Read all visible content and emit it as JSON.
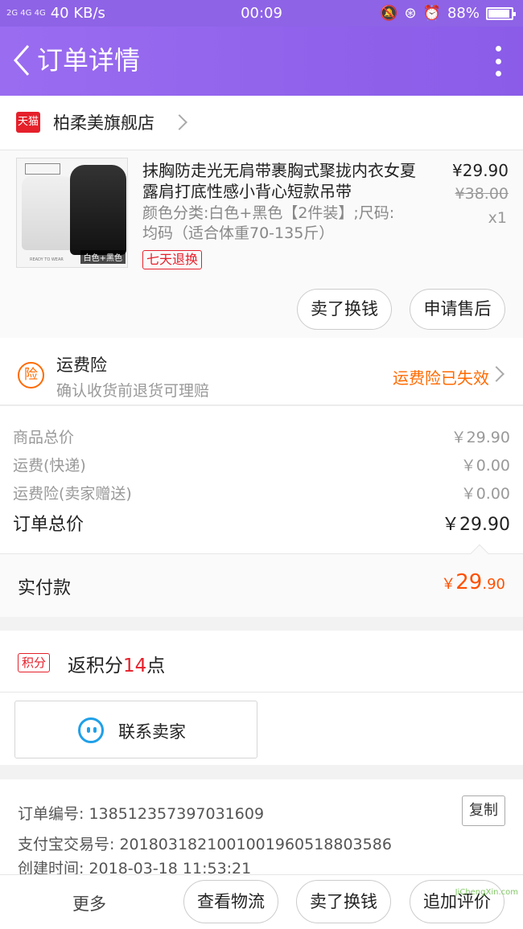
{
  "status": {
    "network": "2G 4G 4G",
    "speed": "40 KB/s",
    "time": "00:09",
    "battery": "88%"
  },
  "header": {
    "title": "订单详情"
  },
  "shop": {
    "badge": "天猫",
    "name": "柏柔美旗舰店"
  },
  "product": {
    "title": "抹胸防走光无肩带裹胸式聚拢内衣女夏露肩打底性感小背心短款吊带",
    "spec": "颜色分类:白色+黑色【2件装】;尺码:均码（适合体重70-135斤）",
    "badge": "七天退换",
    "image_tag": "白色+黑色",
    "image_caption": "READY TO WEAR",
    "price": "¥29.90",
    "original_price": "¥38.00",
    "quantity": "x1",
    "btn_exchange": "卖了换钱",
    "btn_aftersale": "申请售后"
  },
  "insurance": {
    "icon": "险",
    "title": "运费险",
    "subtitle": "确认收货前退货可理赔",
    "status": "运费险已失效"
  },
  "totals": {
    "rows": [
      {
        "label": "商品总价",
        "value": "￥29.90"
      },
      {
        "label": "运费(快递)",
        "value": "￥0.00"
      },
      {
        "label": "运费险(卖家赠送)",
        "value": "￥0.00"
      }
    ],
    "total_label": "订单总价",
    "total_value": "￥29.90"
  },
  "paid": {
    "label": "实付款",
    "currency": "￥",
    "integer": "29",
    "decimal": ".90"
  },
  "points": {
    "badge": "积分",
    "prefix": "返积分",
    "num": "14",
    "suffix": "点"
  },
  "contact": {
    "label": "联系卖家"
  },
  "order_info": {
    "order_no": "订单编号: 138512357397031609",
    "alipay_no": "支付宝交易号: 2018031821001001960518803586",
    "created": "创建时间: 2018-03-18 11:53:21",
    "copy": "复制"
  },
  "bottom": {
    "more": "更多",
    "logistics": "查看物流",
    "exchange": "卖了换钱",
    "review": "追加评价",
    "watermark": "JiChengXin.com"
  },
  "colors": {
    "header": "#8e63e6",
    "accent_orange": "#ff5000",
    "tmall_red": "#e5202b",
    "wangwang_blue": "#20a0e8"
  }
}
